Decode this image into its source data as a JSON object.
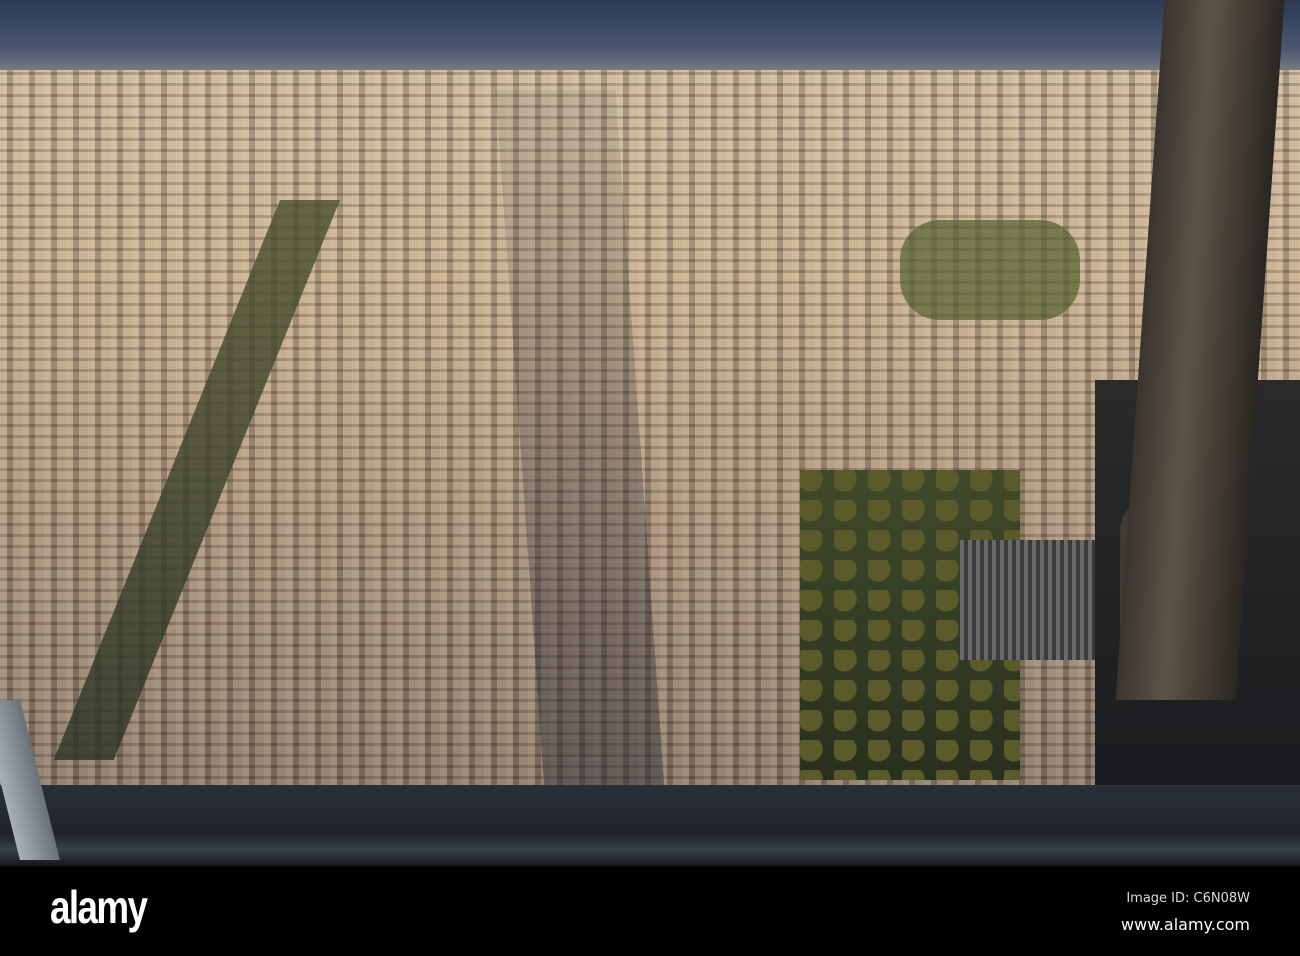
{
  "watermark": {
    "logo": "alamy",
    "image_id": "Image ID: C6N08W",
    "url": "www.alamy.com"
  }
}
